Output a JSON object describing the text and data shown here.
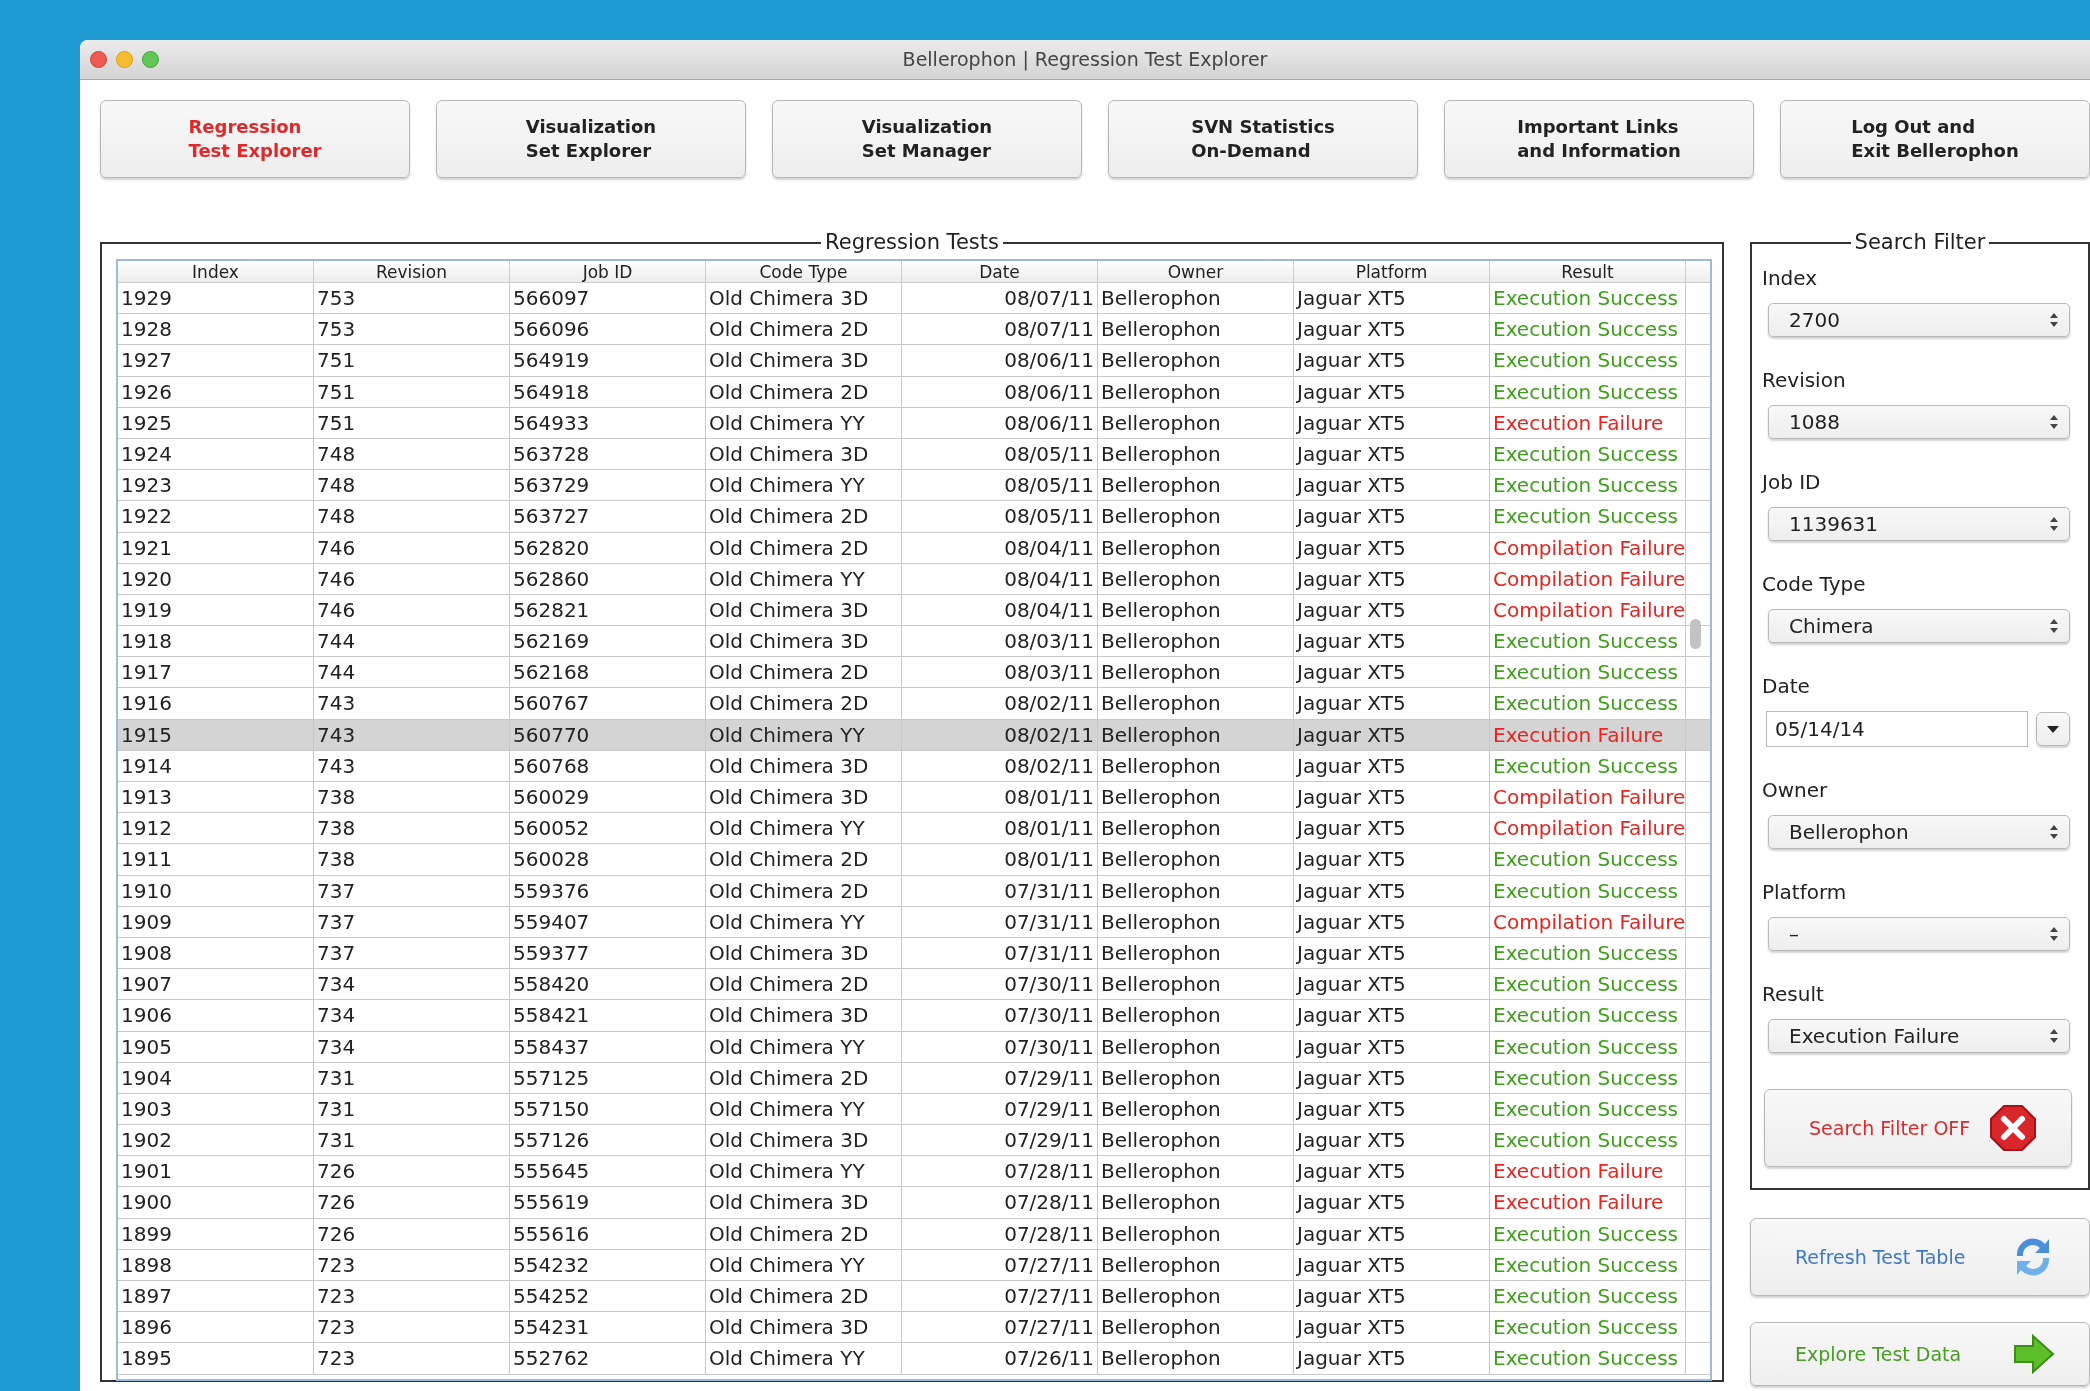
{
  "window": {
    "title": "Bellerophon | Regression Test Explorer"
  },
  "tabs": [
    {
      "label": "Regression\nTest Explorer",
      "selected": true
    },
    {
      "label": "Visualization\nSet Explorer",
      "selected": false
    },
    {
      "label": "Visualization\nSet Manager",
      "selected": false
    },
    {
      "label": "SVN Statistics\nOn-Demand",
      "selected": false
    },
    {
      "label": "Important Links\nand Information",
      "selected": false
    },
    {
      "label": "Log Out and\nExit Bellerophon",
      "selected": false
    }
  ],
  "table": {
    "title": "Regression Tests",
    "columns": [
      "Index",
      "Revision",
      "Job ID",
      "Code Type",
      "Date",
      "Owner",
      "Platform",
      "Result"
    ],
    "rows": [
      {
        "cells": [
          "1929",
          "753",
          "566097",
          "Old Chimera 3D",
          "08/07/11",
          "Bellerophon",
          "Jaguar XT5",
          "Execution Success"
        ],
        "color": "#3f9f1c",
        "selected": false
      },
      {
        "cells": [
          "1928",
          "753",
          "566096",
          "Old Chimera 2D",
          "08/07/11",
          "Bellerophon",
          "Jaguar XT5",
          "Execution Success"
        ],
        "color": "#3f9f1c",
        "selected": false
      },
      {
        "cells": [
          "1927",
          "751",
          "564919",
          "Old Chimera 3D",
          "08/06/11",
          "Bellerophon",
          "Jaguar XT5",
          "Execution Success"
        ],
        "color": "#3f9f1c",
        "selected": false
      },
      {
        "cells": [
          "1926",
          "751",
          "564918",
          "Old Chimera 2D",
          "08/06/11",
          "Bellerophon",
          "Jaguar XT5",
          "Execution Success"
        ],
        "color": "#3f9f1c",
        "selected": false
      },
      {
        "cells": [
          "1925",
          "751",
          "564933",
          "Old Chimera YY",
          "08/06/11",
          "Bellerophon",
          "Jaguar XT5",
          "Execution Failure"
        ],
        "color": "#e8241f",
        "selected": false
      },
      {
        "cells": [
          "1924",
          "748",
          "563728",
          "Old Chimera 3D",
          "08/05/11",
          "Bellerophon",
          "Jaguar XT5",
          "Execution Success"
        ],
        "color": "#3f9f1c",
        "selected": false
      },
      {
        "cells": [
          "1923",
          "748",
          "563729",
          "Old Chimera YY",
          "08/05/11",
          "Bellerophon",
          "Jaguar XT5",
          "Execution Success"
        ],
        "color": "#3f9f1c",
        "selected": false
      },
      {
        "cells": [
          "1922",
          "748",
          "563727",
          "Old Chimera 2D",
          "08/05/11",
          "Bellerophon",
          "Jaguar XT5",
          "Execution Success"
        ],
        "color": "#3f9f1c",
        "selected": false
      },
      {
        "cells": [
          "1921",
          "746",
          "562820",
          "Old Chimera 2D",
          "08/04/11",
          "Bellerophon",
          "Jaguar XT5",
          "Compilation Failure"
        ],
        "color": "#e8241f",
        "selected": false
      },
      {
        "cells": [
          "1920",
          "746",
          "562860",
          "Old Chimera YY",
          "08/04/11",
          "Bellerophon",
          "Jaguar XT5",
          "Compilation Failure"
        ],
        "color": "#e8241f",
        "selected": false
      },
      {
        "cells": [
          "1919",
          "746",
          "562821",
          "Old Chimera 3D",
          "08/04/11",
          "Bellerophon",
          "Jaguar XT5",
          "Compilation Failure"
        ],
        "color": "#e8241f",
        "selected": false
      },
      {
        "cells": [
          "1918",
          "744",
          "562169",
          "Old Chimera 3D",
          "08/03/11",
          "Bellerophon",
          "Jaguar XT5",
          "Execution Success"
        ],
        "color": "#3f9f1c",
        "selected": false
      },
      {
        "cells": [
          "1917",
          "744",
          "562168",
          "Old Chimera 2D",
          "08/03/11",
          "Bellerophon",
          "Jaguar XT5",
          "Execution Success"
        ],
        "color": "#3f9f1c",
        "selected": false
      },
      {
        "cells": [
          "1916",
          "743",
          "560767",
          "Old Chimera 2D",
          "08/02/11",
          "Bellerophon",
          "Jaguar XT5",
          "Execution Success"
        ],
        "color": "#3f9f1c",
        "selected": false
      },
      {
        "cells": [
          "1915",
          "743",
          "560770",
          "Old Chimera YY",
          "08/02/11",
          "Bellerophon",
          "Jaguar XT5",
          "Execution Failure"
        ],
        "color": "#e8241f",
        "selected": true
      },
      {
        "cells": [
          "1914",
          "743",
          "560768",
          "Old Chimera 3D",
          "08/02/11",
          "Bellerophon",
          "Jaguar XT5",
          "Execution Success"
        ],
        "color": "#3f9f1c",
        "selected": false
      },
      {
        "cells": [
          "1913",
          "738",
          "560029",
          "Old Chimera 3D",
          "08/01/11",
          "Bellerophon",
          "Jaguar XT5",
          "Compilation Failure"
        ],
        "color": "#e8241f",
        "selected": false
      },
      {
        "cells": [
          "1912",
          "738",
          "560052",
          "Old Chimera YY",
          "08/01/11",
          "Bellerophon",
          "Jaguar XT5",
          "Compilation Failure"
        ],
        "color": "#e8241f",
        "selected": false
      },
      {
        "cells": [
          "1911",
          "738",
          "560028",
          "Old Chimera 2D",
          "08/01/11",
          "Bellerophon",
          "Jaguar XT5",
          "Execution Success"
        ],
        "color": "#3f9f1c",
        "selected": false
      },
      {
        "cells": [
          "1910",
          "737",
          "559376",
          "Old Chimera 2D",
          "07/31/11",
          "Bellerophon",
          "Jaguar XT5",
          "Execution Success"
        ],
        "color": "#3f9f1c",
        "selected": false
      },
      {
        "cells": [
          "1909",
          "737",
          "559407",
          "Old Chimera YY",
          "07/31/11",
          "Bellerophon",
          "Jaguar XT5",
          "Compilation Failure"
        ],
        "color": "#e8241f",
        "selected": false
      },
      {
        "cells": [
          "1908",
          "737",
          "559377",
          "Old Chimera 3D",
          "07/31/11",
          "Bellerophon",
          "Jaguar XT5",
          "Execution Success"
        ],
        "color": "#3f9f1c",
        "selected": false
      },
      {
        "cells": [
          "1907",
          "734",
          "558420",
          "Old Chimera 2D",
          "07/30/11",
          "Bellerophon",
          "Jaguar XT5",
          "Execution Success"
        ],
        "color": "#3f9f1c",
        "selected": false
      },
      {
        "cells": [
          "1906",
          "734",
          "558421",
          "Old Chimera 3D",
          "07/30/11",
          "Bellerophon",
          "Jaguar XT5",
          "Execution Success"
        ],
        "color": "#3f9f1c",
        "selected": false
      },
      {
        "cells": [
          "1905",
          "734",
          "558437",
          "Old Chimera YY",
          "07/30/11",
          "Bellerophon",
          "Jaguar XT5",
          "Execution Success"
        ],
        "color": "#3f9f1c",
        "selected": false
      },
      {
        "cells": [
          "1904",
          "731",
          "557125",
          "Old Chimera 2D",
          "07/29/11",
          "Bellerophon",
          "Jaguar XT5",
          "Execution Success"
        ],
        "color": "#3f9f1c",
        "selected": false
      },
      {
        "cells": [
          "1903",
          "731",
          "557150",
          "Old Chimera YY",
          "07/29/11",
          "Bellerophon",
          "Jaguar XT5",
          "Execution Success"
        ],
        "color": "#3f9f1c",
        "selected": false
      },
      {
        "cells": [
          "1902",
          "731",
          "557126",
          "Old Chimera 3D",
          "07/29/11",
          "Bellerophon",
          "Jaguar XT5",
          "Execution Success"
        ],
        "color": "#3f9f1c",
        "selected": false
      },
      {
        "cells": [
          "1901",
          "726",
          "555645",
          "Old Chimera YY",
          "07/28/11",
          "Bellerophon",
          "Jaguar XT5",
          "Execution Failure"
        ],
        "color": "#e8241f",
        "selected": false
      },
      {
        "cells": [
          "1900",
          "726",
          "555619",
          "Old Chimera 3D",
          "07/28/11",
          "Bellerophon",
          "Jaguar XT5",
          "Execution Failure"
        ],
        "color": "#e8241f",
        "selected": false
      },
      {
        "cells": [
          "1899",
          "726",
          "555616",
          "Old Chimera 2D",
          "07/28/11",
          "Bellerophon",
          "Jaguar XT5",
          "Execution Success"
        ],
        "color": "#3f9f1c",
        "selected": false
      },
      {
        "cells": [
          "1898",
          "723",
          "554232",
          "Old Chimera YY",
          "07/27/11",
          "Bellerophon",
          "Jaguar XT5",
          "Execution Success"
        ],
        "color": "#3f9f1c",
        "selected": false
      },
      {
        "cells": [
          "1897",
          "723",
          "554252",
          "Old Chimera 2D",
          "07/27/11",
          "Bellerophon",
          "Jaguar XT5",
          "Execution Success"
        ],
        "color": "#3f9f1c",
        "selected": false
      },
      {
        "cells": [
          "1896",
          "723",
          "554231",
          "Old Chimera 3D",
          "07/27/11",
          "Bellerophon",
          "Jaguar XT5",
          "Execution Success"
        ],
        "color": "#3f9f1c",
        "selected": false
      },
      {
        "cells": [
          "1895",
          "723",
          "552762",
          "Old Chimera YY",
          "07/26/11",
          "Bellerophon",
          "Jaguar XT5",
          "Execution Success"
        ],
        "color": "#3f9f1c",
        "selected": false
      }
    ]
  },
  "search_filter": {
    "title": "Search Filter",
    "fields": [
      {
        "label": "Index",
        "kind": "select",
        "value": "2700"
      },
      {
        "label": "Revision",
        "kind": "select",
        "value": "1088"
      },
      {
        "label": "Job ID",
        "kind": "select",
        "value": "1139631"
      },
      {
        "label": "Code Type",
        "kind": "select",
        "value": "Chimera"
      },
      {
        "label": "Date",
        "kind": "date",
        "value": "05/14/14"
      },
      {
        "label": "Owner",
        "kind": "select",
        "value": "Bellerophon"
      },
      {
        "label": "Platform",
        "kind": "select",
        "value": "–"
      },
      {
        "label": "Result",
        "kind": "select",
        "value": "Execution Failure"
      }
    ],
    "toggle_button": {
      "label": "Search Filter OFF"
    }
  },
  "actions": [
    {
      "label": "Refresh Test Table",
      "kind": "refresh"
    },
    {
      "label": "Explore Test Data",
      "kind": "explore"
    }
  ]
}
